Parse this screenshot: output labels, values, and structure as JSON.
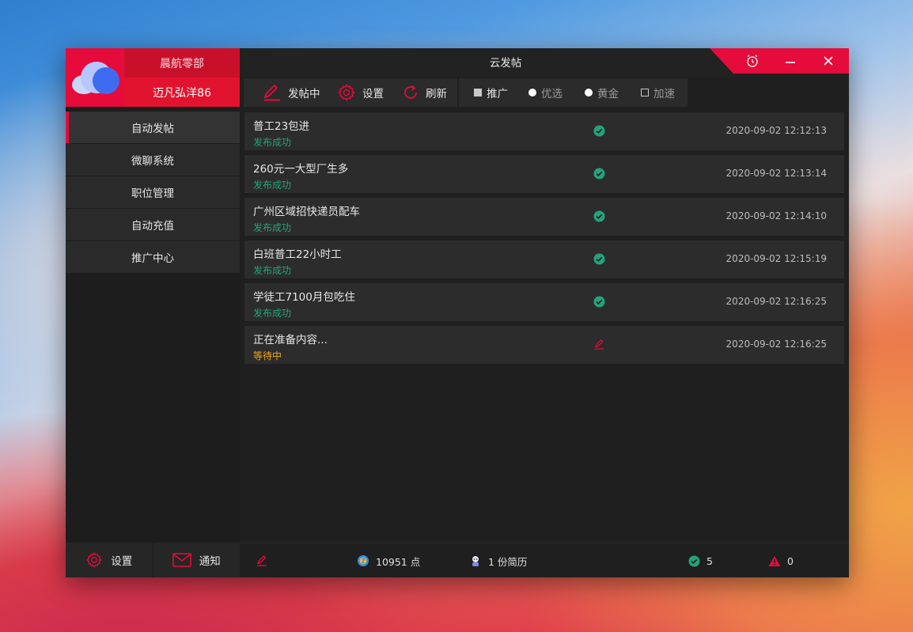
{
  "window": {
    "title": "云发帖"
  },
  "account": {
    "name_top": "晨航零部",
    "name_bottom": "迈凡弘洋86"
  },
  "sidebar": {
    "items": [
      {
        "label": "自动发帖"
      },
      {
        "label": "微聊系统"
      },
      {
        "label": "职位管理"
      },
      {
        "label": "自动充值"
      },
      {
        "label": "推广中心"
      }
    ],
    "settings_label": "设置",
    "notify_label": "通知"
  },
  "toolbar": {
    "posting_label": "发帖中",
    "settings_label": "设置",
    "refresh_label": "刷新",
    "options": [
      {
        "label": "推广"
      },
      {
        "label": "优选"
      },
      {
        "label": "黄金"
      },
      {
        "label": "加速"
      }
    ]
  },
  "posts": [
    {
      "title": "普工23包进",
      "status": "发布成功",
      "time": "2020-09-02 12:12:13"
    },
    {
      "title": "260元一大型厂生多",
      "status": "发布成功",
      "time": "2020-09-02 12:13:14"
    },
    {
      "title": "广州区域招快递员配车",
      "status": "发布成功",
      "time": "2020-09-02 12:14:10"
    },
    {
      "title": "白班普工22小时工",
      "status": "发布成功",
      "time": "2020-09-02 12:15:19"
    },
    {
      "title": "学徒工7100月包吃住",
      "status": "发布成功",
      "time": "2020-09-02 12:16:25"
    },
    {
      "title": "正在准备内容...",
      "status": "等待中",
      "time": "2020-09-02 12:16:25"
    }
  ],
  "statusbar": {
    "points": "10951 点",
    "resumes": "1 份简历",
    "success_count": "5",
    "warning_count": "0"
  },
  "colors": {
    "accent": "#e50b3b",
    "success": "#25a27b",
    "waiting": "#f0a51e",
    "panel": "#2c2c2c"
  }
}
